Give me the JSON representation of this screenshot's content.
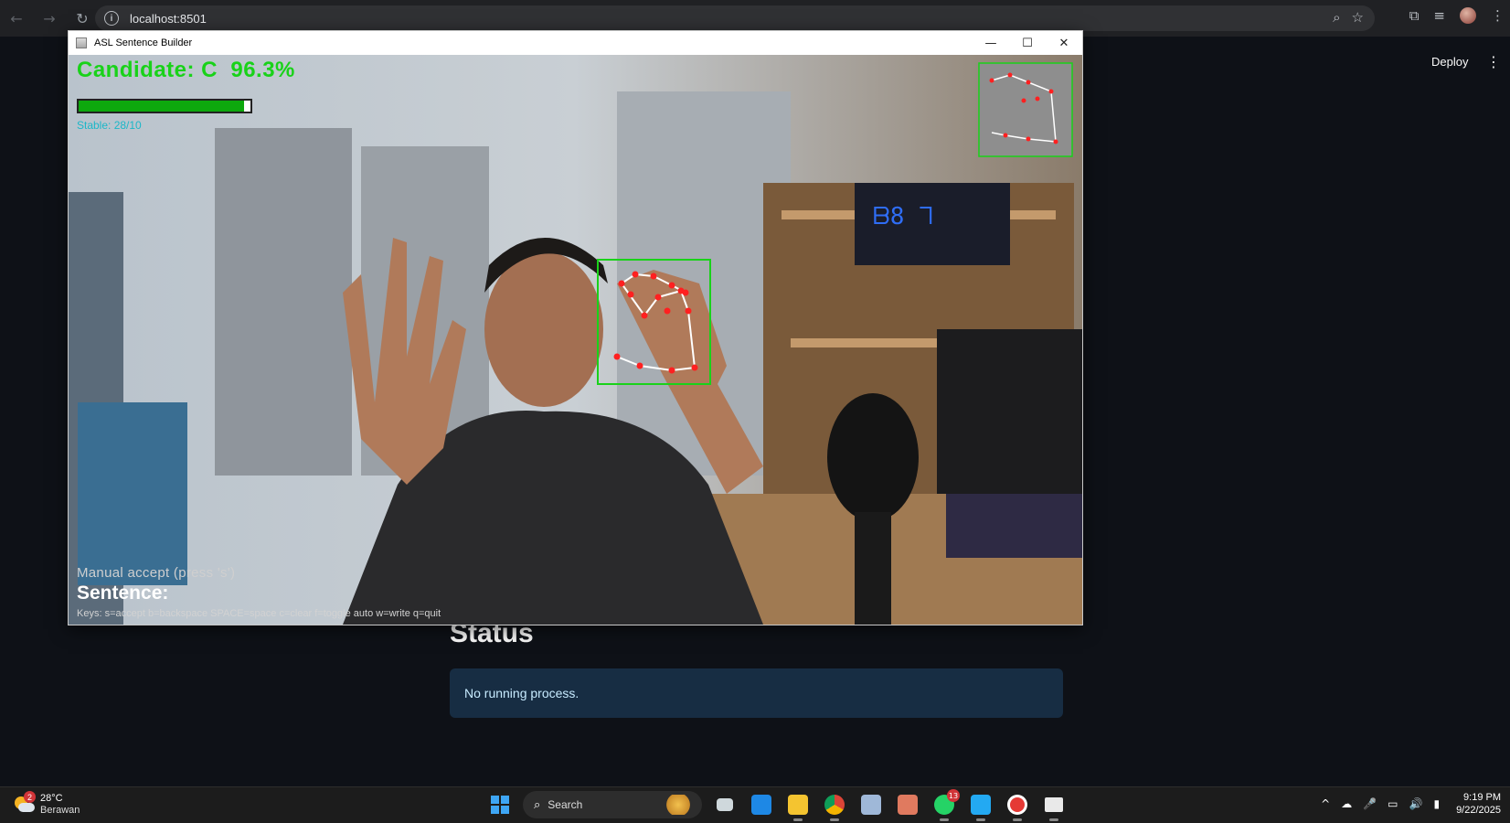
{
  "browser": {
    "url": "localhost:8501",
    "back_icon": "←",
    "forward_icon": "→",
    "reload_icon": "↻",
    "info_icon": "i",
    "zoom_icon": "⌕",
    "star_icon": "☆",
    "extensions_icon": "⧉",
    "media_icon": "≡",
    "menu_icon": "⋮"
  },
  "streamlit": {
    "deploy_label": "Deploy",
    "menu_icon": "⋮",
    "status_heading": "Status",
    "status_message": "No running process."
  },
  "cv_window": {
    "title": "ASL Sentence Builder",
    "minimize": "—",
    "maximize": "☐",
    "close": "✕",
    "candidate_text": "Candidate: C  96.3%",
    "confidence": 0.963,
    "stable_text": "Stable: 28/10",
    "manual_text": "Manual accept (press 's')",
    "sentence_label": "Sentence:",
    "keys_text": "Keys: s=accept b=backspace SPACE=space c=clear f=toggle auto w=write q=quit"
  },
  "taskbar": {
    "weather_temp": "28°C",
    "weather_desc": "Berawan",
    "weather_badge": "2",
    "search_label": "Search",
    "search_icon": "⌕",
    "whatsapp_badge": "13",
    "time": "9:19 PM",
    "date": "9/22/2025",
    "tray_icons": [
      "^",
      "☁",
      "🎤",
      "▭",
      "🔊",
      "▮"
    ],
    "accent_colors": {
      "start": "#3ea6f5",
      "task_view": "#cfd8dc",
      "photos": "#1e88e5",
      "explorer": "#f4c430",
      "chrome": "#db4437",
      "store": "#9fb8d8",
      "game": "#e07a5f",
      "whatsapp": "#25d366",
      "vscode": "#23a9f2",
      "recorder": "#e53935",
      "python_window": "#e9e9e9"
    }
  }
}
